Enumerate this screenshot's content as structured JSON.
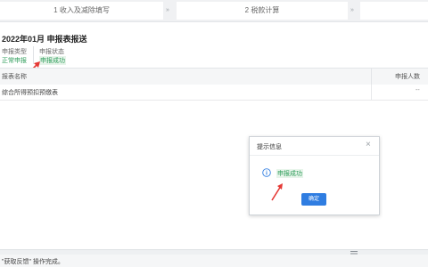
{
  "steps": [
    {
      "label": "1 收入及减除填写"
    },
    {
      "label": "2 税款计算"
    },
    {
      "label": ""
    }
  ],
  "step_separator": "»",
  "page_title": "2022年01月  申报表报送",
  "declare_type": {
    "label": "申报类型",
    "value": "正常申报"
  },
  "declare_status": {
    "label": "申报状态",
    "value": "申报成功"
  },
  "table": {
    "columns": [
      "报表名称",
      "申报人数"
    ],
    "rows": [
      {
        "name": "综合所得预扣预缴表",
        "count": "--"
      }
    ]
  },
  "dialog": {
    "title": "提示信息",
    "close": "×",
    "message": "申报成功",
    "ok_label": "确定"
  },
  "status_bar": {
    "text": "\"获取反馈\" 操作完成。"
  },
  "colors": {
    "accent": "#2f7de1",
    "success": "#2e9d5a",
    "annotation": "#e53935"
  }
}
